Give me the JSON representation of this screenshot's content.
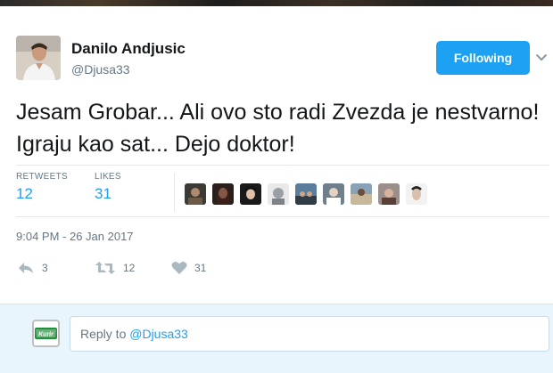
{
  "user": {
    "name": "Danilo Andjusic",
    "handle": "@Djusa33"
  },
  "follow_button": {
    "label": "Following"
  },
  "tweet": {
    "text": "Jesam Grobar... Ali ovo sto radi Zvezda je nestvarno! Igraju kao sat... Dejo doktor!"
  },
  "stats": {
    "retweets_label": "RETWEETS",
    "retweets_value": "12",
    "likes_label": "LIKES",
    "likes_value": "31"
  },
  "timestamp": "9:04 PM - 26 Jan 2017",
  "actions": {
    "reply_count": "3",
    "retweet_count": "12",
    "like_count": "31"
  },
  "reply_box": {
    "prefix": "Reply to ",
    "mention": "@Djusa33",
    "avatar_text": "Kurir"
  },
  "colors": {
    "accent": "#1da1f2",
    "muted": "#657786",
    "reply_bg": "#e8f5fd"
  },
  "icons": [
    "reply-icon",
    "retweet-icon",
    "heart-icon",
    "chevron-down-icon"
  ]
}
